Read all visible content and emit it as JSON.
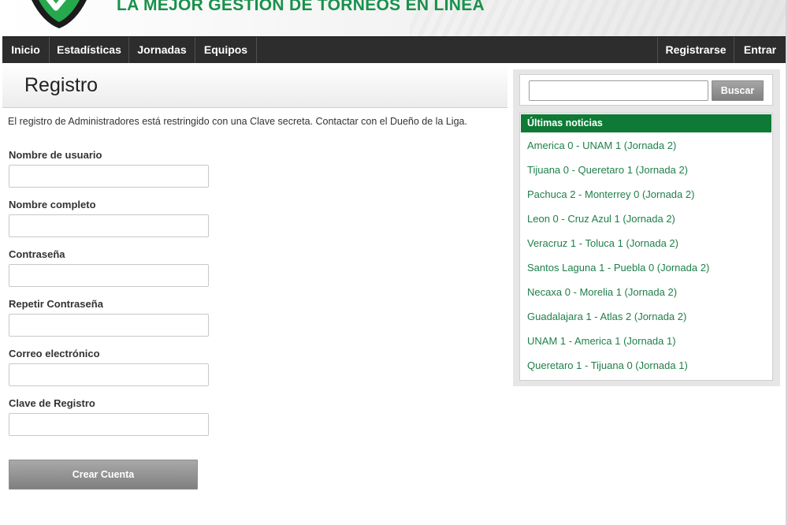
{
  "header": {
    "slogan": "LA MEJOR GESTION DE TORNEOS EN LINEA",
    "logo_icon": "shield-check-logo",
    "slogan_color": "#18914a"
  },
  "nav": {
    "left": [
      "Inicio",
      "Estadísticas",
      "Jornadas",
      "Equipos"
    ],
    "right": [
      "Registrarse",
      "Entrar"
    ]
  },
  "main": {
    "title": "Registro",
    "intro": "El registro de Administradores está restringido con una Clave secreta. Contactar con el Dueño de la Liga.",
    "fields": [
      {
        "label": "Nombre de usuario",
        "value": ""
      },
      {
        "label": "Nombre completo",
        "value": ""
      },
      {
        "label": "Contraseña",
        "value": ""
      },
      {
        "label": "Repetir Contraseña",
        "value": ""
      },
      {
        "label": "Correo electrónico",
        "value": ""
      },
      {
        "label": "Clave de Registro",
        "value": ""
      }
    ],
    "submit_label": "Crear Cuenta"
  },
  "sidebar": {
    "search": {
      "value": "",
      "button_label": "Buscar"
    },
    "news_title": "Últimas noticias",
    "news": [
      "America 0 - UNAM 1 (Jornada 2)",
      "Tijuana 0 - Queretaro 1 (Jornada 2)",
      "Pachuca 2 - Monterrey 0 (Jornada 2)",
      "Leon 0 - Cruz Azul 1 (Jornada 2)",
      "Veracruz 1 - Toluca 1 (Jornada 2)",
      "Santos Laguna 1 - Puebla 0 (Jornada 2)",
      "Necaxa 0 - Morelia 1 (Jornada 2)",
      "Guadalajara 1 - Atlas 2 (Jornada 2)",
      "UNAM 1 - America 1 (Jornada 1)",
      "Queretaro 1 - Tijuana 0 (Jornada 1)"
    ],
    "accent": "#0e7a36",
    "link_color": "#1f7f4a"
  }
}
